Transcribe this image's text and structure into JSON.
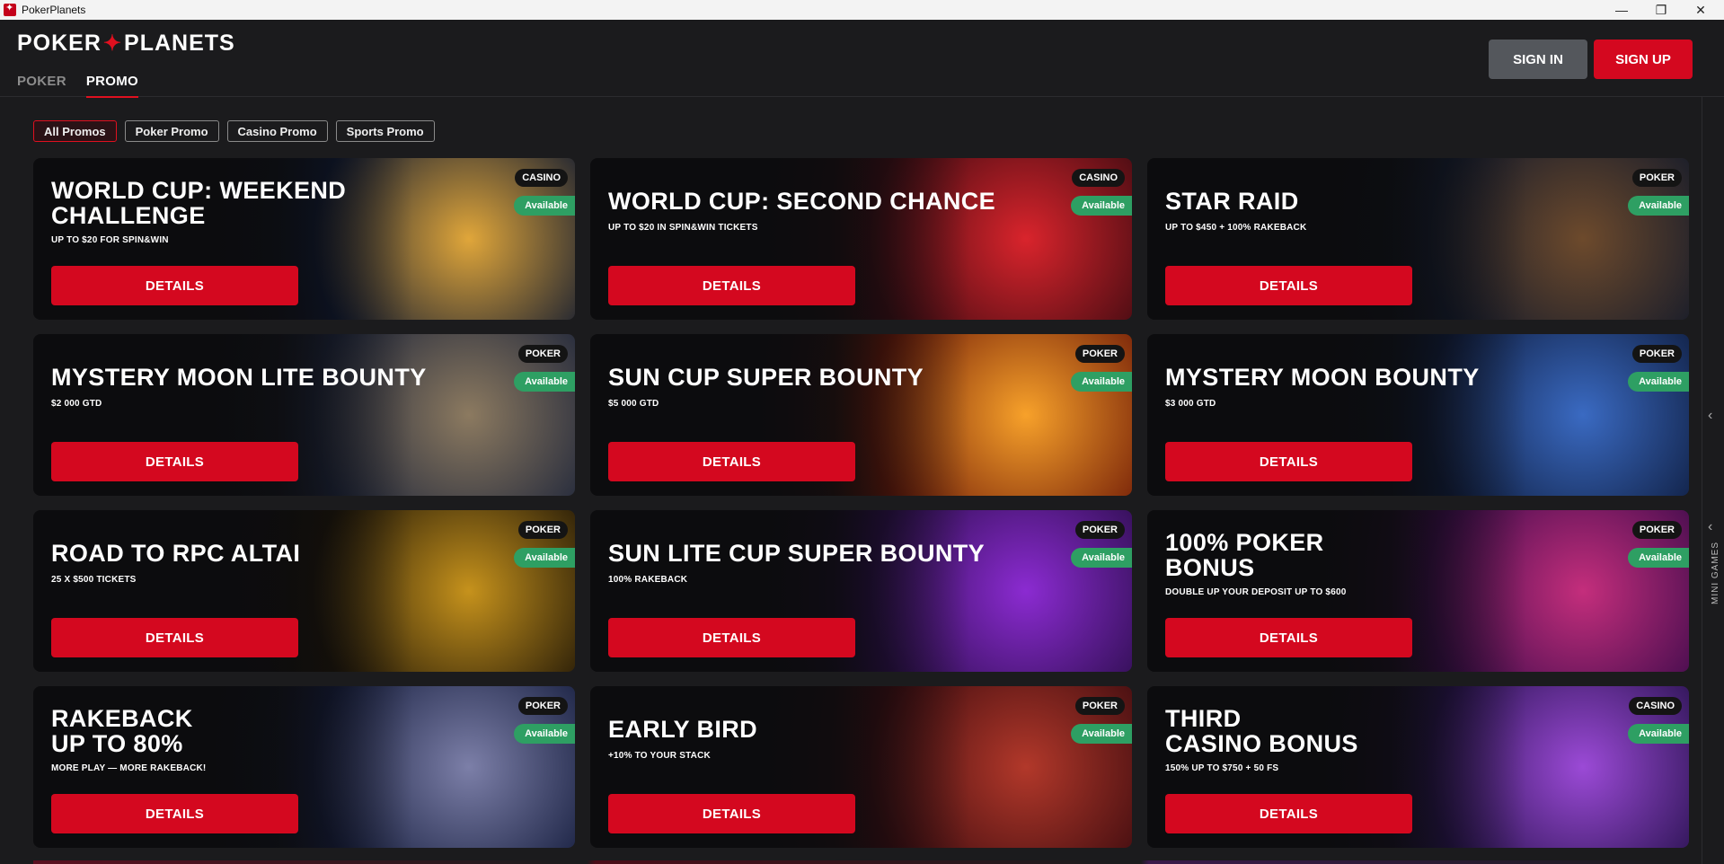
{
  "window": {
    "title": "PokerPlanets",
    "minimize": "—",
    "maximize": "❐",
    "close": "✕"
  },
  "header": {
    "logo_left": "POKER",
    "logo_right": "PLANETS",
    "tabs": [
      {
        "label": "POKER",
        "active": false
      },
      {
        "label": "PROMO",
        "active": true
      }
    ],
    "sign_in": "SIGN IN",
    "sign_up": "SIGN UP"
  },
  "filters": [
    {
      "label": "All Promos",
      "active": true
    },
    {
      "label": "Poker Promo",
      "active": false
    },
    {
      "label": "Casino Promo",
      "active": false
    },
    {
      "label": "Sports Promo",
      "active": false
    }
  ],
  "promos": [
    {
      "title": "WORLD CUP: WEEKEND\nCHALLENGE",
      "subtitle": "UP TO $20 FOR SPIN&WIN",
      "category": "CASINO",
      "status": "Available",
      "button": "DETAILS",
      "colors": [
        "#0b1630",
        "#e0a63a"
      ]
    },
    {
      "title": "WORLD CUP: SECOND CHANCE",
      "subtitle": "UP TO $20 IN SPIN&WIN TICKETS",
      "category": "CASINO",
      "status": "Available",
      "button": "DETAILS",
      "colors": [
        "#3a0a10",
        "#d9242c"
      ]
    },
    {
      "title": "STAR RAID",
      "subtitle": "UP TO $450 + 100% RAKEBACK",
      "category": "POKER",
      "status": "Available",
      "button": "DETAILS",
      "colors": [
        "#10182a",
        "#6d4a2c"
      ]
    },
    {
      "title": "MYSTERY MOON LITE BOUNTY",
      "subtitle": "$2 000 GTD",
      "category": "POKER",
      "status": "Available",
      "button": "DETAILS",
      "colors": [
        "#1a2238",
        "#8c7a60"
      ]
    },
    {
      "title": "SUN CUP SUPER BOUNTY",
      "subtitle": "$5 000 GTD",
      "category": "POKER",
      "status": "Available",
      "button": "DETAILS",
      "colors": [
        "#6b1606",
        "#f7a12a"
      ]
    },
    {
      "title": "MYSTERY MOON BOUNTY",
      "subtitle": "$3 000 GTD",
      "category": "POKER",
      "status": "Available",
      "button": "DETAILS",
      "colors": [
        "#0d1a3a",
        "#3a6ac2"
      ]
    },
    {
      "title": "ROAD TO RPC ALTAI",
      "subtitle": "25 X $500 TICKETS",
      "category": "POKER",
      "status": "Available",
      "button": "DETAILS",
      "colors": [
        "#1a1206",
        "#c6921c"
      ]
    },
    {
      "title": "SUN LITE CUP SUPER BOUNTY",
      "subtitle": "100% RAKEBACK",
      "category": "POKER",
      "status": "Available",
      "button": "DETAILS",
      "colors": [
        "#2a0d4a",
        "#8b2bd1"
      ]
    },
    {
      "title": "100% POKER\nBONUS",
      "subtitle": "DOUBLE UP YOUR DEPOSIT UP TO $600",
      "category": "POKER",
      "status": "Available",
      "button": "DETAILS",
      "colors": [
        "#3a0a4a",
        "#c42e7c"
      ]
    },
    {
      "title": "RAKEBACK\nUP TO 80%",
      "subtitle": "MORE PLAY — MORE RAKEBACK!",
      "category": "POKER",
      "status": "Available",
      "button": "DETAILS",
      "colors": [
        "#121a3a",
        "#7c7fa8"
      ]
    },
    {
      "title": "EARLY BIRD",
      "subtitle": "+10% TO YOUR STACK",
      "category": "POKER",
      "status": "Available",
      "button": "DETAILS",
      "colors": [
        "#3a0a0e",
        "#b2382a"
      ]
    },
    {
      "title": "THIRD\nCASINO BONUS",
      "subtitle": "150% UP TO $750 + 50 FS",
      "category": "CASINO",
      "status": "Available",
      "button": "DETAILS",
      "colors": [
        "#24104a",
        "#9b4ad6"
      ]
    }
  ],
  "side_rail": {
    "label": "MINI GAMES",
    "chevron": "‹"
  }
}
